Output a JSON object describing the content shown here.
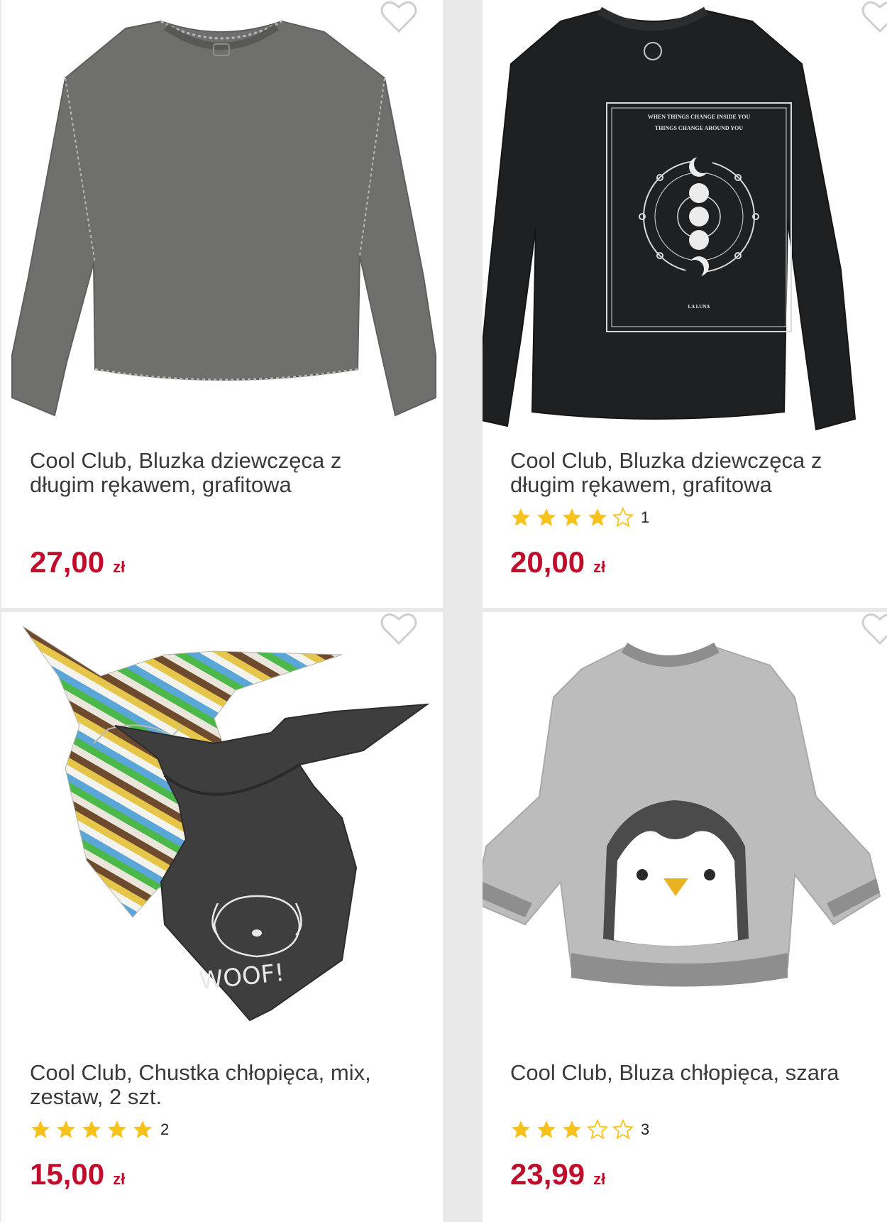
{
  "colors": {
    "price": "#c00d2c",
    "star_filled": "#f7c21b",
    "title_text": "#3a3a3a",
    "background": "#e9e9e9",
    "card": "#ffffff"
  },
  "products": [
    {
      "image": "gray long-sleeve top",
      "title": "Cool Club, Bluzka dziewczęca z długim rękawem, grafitowa",
      "price": "27,00",
      "currency": "zł"
    },
    {
      "image": "black long-sleeve top with moon print",
      "title": "Cool Club, Bluzka dziewczęca z długim rękawem, grafitowa",
      "rating_stars": 4,
      "rating_count": "1",
      "price": "20,00",
      "currency": "zł"
    },
    {
      "image": "two bandana scarves",
      "title": "Cool Club, Chustka chłopięca, mix, zestaw, 2 szt.",
      "rating_stars": 5,
      "rating_count": "2",
      "price": "15,00",
      "currency": "zł"
    },
    {
      "image": "gray fleece sweatshirt with penguin",
      "title": "Cool Club, Bluza chłopięca, szara",
      "rating_stars": 3,
      "rating_count": "3",
      "price": "23,99",
      "currency": "zł"
    }
  ],
  "print_text": {
    "line1": "WHEN THINGS CHANGE INSIDE YOU",
    "line2": "THINGS CHANGE AROUND YOU",
    "line3": "LA LUNA",
    "woof": "WOOF!"
  }
}
